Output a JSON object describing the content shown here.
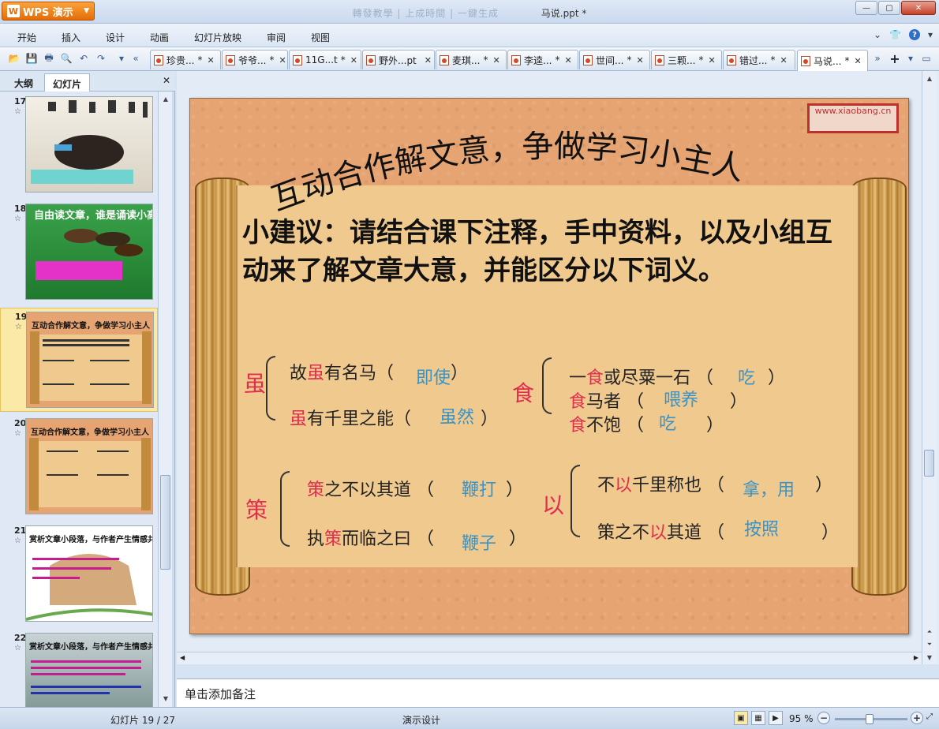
{
  "app": {
    "brand": "WPS 演示",
    "window_title": "马说.ppt *",
    "title_faded_text": "轉發教學 | 上成時間 | 一鍵生成"
  },
  "menu": [
    "开始",
    "插入",
    "设计",
    "动画",
    "幻灯片放映",
    "审阅",
    "视图"
  ],
  "tabs": [
    {
      "label": "珍贵...",
      "mark": "*"
    },
    {
      "label": "爷爷...",
      "mark": "*"
    },
    {
      "label": "11G...t",
      "mark": "*"
    },
    {
      "label": "野外...pt",
      "mark": ""
    },
    {
      "label": "麦琪...",
      "mark": "*"
    },
    {
      "label": "李逵...",
      "mark": "*"
    },
    {
      "label": "世间...",
      "mark": "*"
    },
    {
      "label": "三颗...",
      "mark": "*"
    },
    {
      "label": "错过...",
      "mark": "*"
    },
    {
      "label": "马说...",
      "mark": "*"
    }
  ],
  "left_panel": {
    "tab_outline": "大纲",
    "tab_slides": "幻灯片",
    "thumbs": [
      {
        "num": "17",
        "star": "☆",
        "title": ""
      },
      {
        "num": "18",
        "star": "☆",
        "title": "自由读文章，谁是诵读小高手"
      },
      {
        "num": "19",
        "star": "☆",
        "title": "互动合作解文意，争做学习小主人"
      },
      {
        "num": "20",
        "star": "☆",
        "title": "互动合作解文意，争做学习小主人"
      },
      {
        "num": "21",
        "star": "☆",
        "title": "赏析文章小段落，与作者产生情感共鸣"
      },
      {
        "num": "22",
        "star": "☆",
        "title": "赏析文章小段落，与作者产生情感共鸣"
      }
    ]
  },
  "slide": {
    "stamp": "www.xiaobang.cn",
    "title": "互动合作解文意，争做学习小主人",
    "suggestion": "小建议：请结合课下注释，手中资料，以及小组互动来了解文章大意，并能区分以下词义。",
    "groups": {
      "sui": {
        "char": "虽",
        "l1_a": "故",
        "l1_b": "虽",
        "l1_c": "有名马（",
        "l1_ans": "即使",
        "l1_end": "）",
        "l2_a": "虽",
        "l2_b": "有千里之能（",
        "l2_ans": "虽然",
        "l2_end": "）"
      },
      "shi": {
        "char": "食",
        "l1_a": "一",
        "l1_b": "食",
        "l1_c": "或尽粟一石 （",
        "l1_ans": "吃",
        "l1_end": "）",
        "l2_a": "食",
        "l2_b": "马者 （",
        "l2_ans": "喂养",
        "l2_end": "）",
        "l3_a": "食",
        "l3_b": "不饱 （",
        "l3_ans": "吃",
        "l3_end": "）"
      },
      "ce": {
        "char": "策",
        "l1_a": "策",
        "l1_b": "之不以其道 （",
        "l1_ans": "鞭打",
        "l1_end": "）",
        "l2_a": "执",
        "l2_b": "策",
        "l2_c": "而临之曰 （",
        "l2_ans": "鞭子",
        "l2_end": "）"
      },
      "yi": {
        "char": "以",
        "l1_a": "不",
        "l1_b": "以",
        "l1_c": "千里称也 （",
        "l1_ans": "拿，用",
        "l1_end": "）",
        "l2_a": "策之不",
        "l2_b": "以",
        "l2_c": "其道 （",
        "l2_ans": "按照",
        "l2_end": "）"
      }
    }
  },
  "notes_placeholder": "单击添加备注",
  "status": {
    "slide_counter": "幻灯片 19 / 27",
    "design": "演示设计",
    "zoom": "95 %",
    "zoom_level": 0.48
  },
  "colors": {
    "accent_orange": "#e46c08",
    "red_char": "#e02e4e",
    "answer_blue": "#3a93c6"
  }
}
